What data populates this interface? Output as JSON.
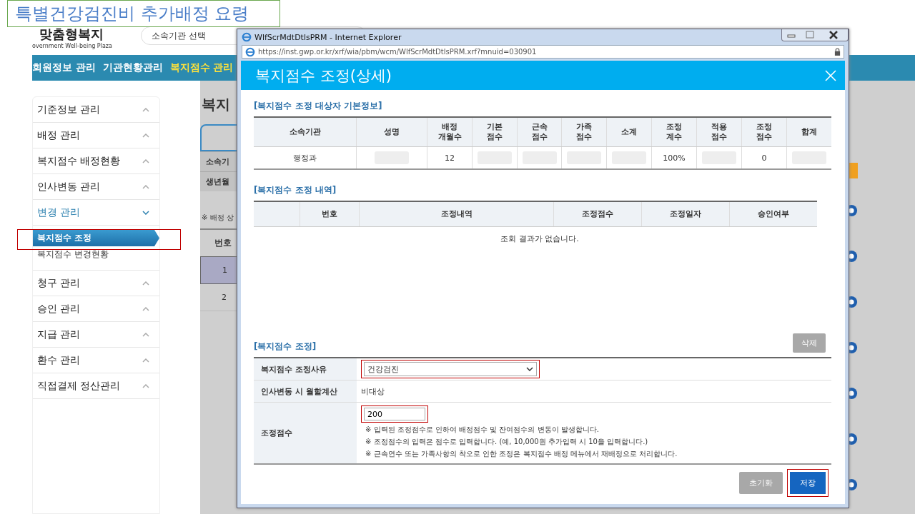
{
  "slide_title": "특별건강검진비 추가배정 요령",
  "site": {
    "logo": "맞춤형복지",
    "logo_sub": "overnment Well-being Plaza",
    "search_placeholder": "소속기관 선택"
  },
  "nav": [
    {
      "label": "회원정보 관리",
      "selected": false
    },
    {
      "label": "기관현황관리",
      "selected": false
    },
    {
      "label": "복지점수 관리",
      "selected": true
    }
  ],
  "sidebar": [
    {
      "label": "기준정보 관리",
      "expanded": false
    },
    {
      "label": "배정 관리",
      "expanded": false
    },
    {
      "label": "복지점수 배정현황",
      "expanded": false
    },
    {
      "label": "인사변동 관리",
      "expanded": false
    },
    {
      "label": "변경 관리",
      "expanded": true,
      "children": [
        {
          "label": "복지점수 조정",
          "selected": true
        },
        {
          "label": "복지점수 변경현황",
          "selected": false
        }
      ]
    },
    {
      "label": "청구 관리",
      "expanded": false
    },
    {
      "label": "승인 관리",
      "expanded": false
    },
    {
      "label": "지급 관리",
      "expanded": false
    },
    {
      "label": "환수 관리",
      "expanded": false
    },
    {
      "label": "직접결제 정산관리",
      "expanded": false
    }
  ],
  "main": {
    "heading": "복지",
    "fields": [
      "소속기",
      "생년월"
    ],
    "note": "※ 배정 상",
    "table_header": "번호",
    "rows": [
      {
        "number": "1",
        "selected": true
      },
      {
        "number": "2",
        "selected": false
      }
    ]
  },
  "popup": {
    "window_title": "WlfScrMdtDtlsPRM - Internet Explorer",
    "url": "https://inst.gwp.or.kr/xrf/wia/pbm/wcm/WlfScrMdtDtlsPRM.xrf?mnuid=030901",
    "title": "복지점수 조정(상세)",
    "basic": {
      "heading": "[복지점수 조정 대상자 기본정보]",
      "columns": [
        "소속기관",
        "성명",
        "배정\n개월수",
        "기본\n점수",
        "근속\n점수",
        "가족\n점수",
        "소계",
        "조정\n계수",
        "적용\n점수",
        "조정\n점수",
        "합계"
      ],
      "row": [
        {
          "text": "행정과",
          "redacted": false
        },
        {
          "redacted": true
        },
        {
          "text": "12",
          "redacted": false
        },
        {
          "redacted": true
        },
        {
          "redacted": true
        },
        {
          "redacted": true
        },
        {
          "redacted": true
        },
        {
          "text": "100%",
          "redacted": false
        },
        {
          "redacted": true
        },
        {
          "text": "0",
          "redacted": false
        },
        {
          "redacted": true
        }
      ]
    },
    "history": {
      "heading": "[복지점수 조정 내역]",
      "columns": [
        "번호",
        "조정내역",
        "조정점수",
        "조정일자",
        "승인여부"
      ],
      "empty_message": "조회 결과가 없습니다."
    },
    "delete_button": "삭제",
    "adjust": {
      "heading": "[복지점수 조정]",
      "reason_label": "복지점수 조정사유",
      "reason_value": "건강검진",
      "prorate_label": "인사변동 시 월할계산",
      "prorate_value": "비대상",
      "score_label": "조정점수",
      "score_value": "200",
      "notes": [
        "※ 입력된 조정점수로 인하여 배정점수 및 잔여점수의 변동이 발생합니다.",
        "※ 조정점수의 입력은 점수로 입력합니다. (예, 10,000원 추가입력 시 10을 입력합니다.)",
        "※ 근속연수 또는 가족사항의 착오로 인한 조정은 복지점수 배정 메뉴에서 재배정으로 처리합니다."
      ]
    },
    "buttons": [
      {
        "label": "초기화",
        "kind": "secondary"
      },
      {
        "label": "저장",
        "kind": "primary"
      }
    ]
  }
}
